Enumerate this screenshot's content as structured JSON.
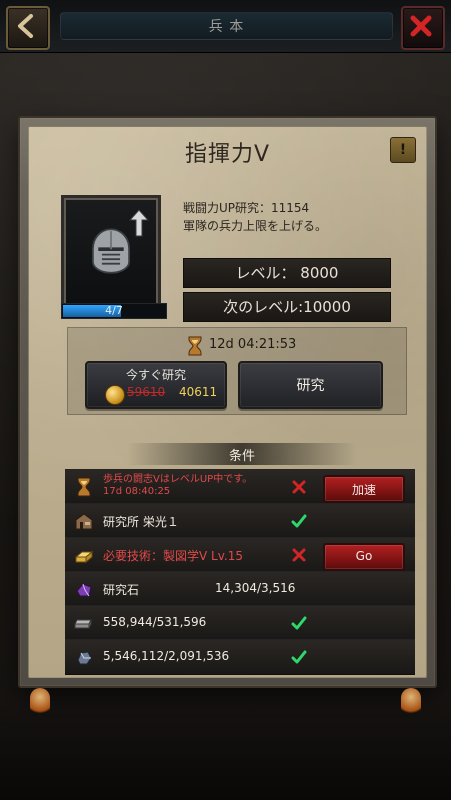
{
  "top": {
    "title": "兵 本"
  },
  "panel": {
    "title": "指揮力V",
    "info_button": "!"
  },
  "research": {
    "progress": "4/7",
    "progress_fraction": 0.57,
    "line1": "戦闘力UP研究：11154",
    "line2": "軍隊の兵力上限を上げる。",
    "level": "レベル： 8000",
    "next_level": "次のレベル:10000"
  },
  "timing": {
    "time": "12d 04:21:53"
  },
  "buttons": {
    "instant_label": "今すぐ研究",
    "old_price": "59610",
    "new_price": "40611",
    "research_label": "研究"
  },
  "conditions": {
    "header": "条件",
    "rows": [
      {
        "icon": "hourglass-icon",
        "text_l1": "歩兵の闘志VはレベルUP中です。",
        "text_l2": "17d 08:40:25",
        "status": "fail",
        "action": "加速"
      },
      {
        "icon": "lab-building-icon",
        "text": "研究所 栄光１",
        "status": "ok",
        "action": ""
      },
      {
        "icon": "gold-bar-icon",
        "text": "必要技術：製図学V Lv.15",
        "status": "fail",
        "action": "Go"
      },
      {
        "icon": "research-stone-icon",
        "text": "研究石",
        "qty": "14,304/3,516",
        "status": "none",
        "action": ""
      },
      {
        "icon": "iron-icon",
        "text": "558,944/531,596",
        "status": "ok",
        "action": ""
      },
      {
        "icon": "ore-icon",
        "text": "5,546,112/2,091,536",
        "status": "ok",
        "action": ""
      }
    ]
  },
  "colors": {
    "red": "#e04a4a",
    "green_check": "#2fd86a",
    "gold": "#f1d15c",
    "progress_blue": "#2ea6ff"
  }
}
